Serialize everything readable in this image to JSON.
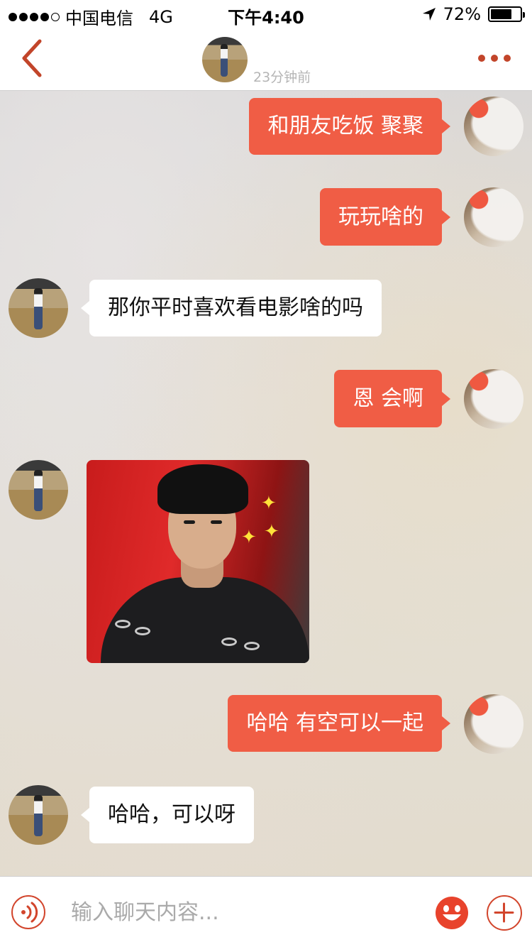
{
  "status_bar": {
    "carrier": "中国电信",
    "network": "4G",
    "time": "下午4:40",
    "battery": "72%",
    "battery_level": 0.72,
    "signal_filled": 4,
    "signal_total": 5
  },
  "header": {
    "last_seen": "23分钟前"
  },
  "messages": [
    {
      "direction": "out",
      "type": "text",
      "text": "和朋友吃饭 聚聚"
    },
    {
      "direction": "out",
      "type": "text",
      "text": "玩玩啥的"
    },
    {
      "direction": "in",
      "type": "text",
      "text": "那你平时喜欢看电影啥的吗"
    },
    {
      "direction": "out",
      "type": "text",
      "text": "恩 会啊"
    },
    {
      "direction": "in",
      "type": "image"
    },
    {
      "direction": "out",
      "type": "text",
      "text": "哈哈 有空可以一起"
    },
    {
      "direction": "in",
      "type": "text",
      "text": "哈哈，可以呀"
    }
  ],
  "input": {
    "placeholder": "输入聊天内容...",
    "value": ""
  },
  "colors": {
    "accent": "#f05d45",
    "icon": "#d2452c",
    "header_icon": "#c2452a",
    "incoming_bubble": "#ffffff"
  },
  "icons": [
    "back-arrow-icon",
    "more-dots-icon",
    "voice-icon",
    "emoji-icon",
    "plus-icon",
    "location-arrow-icon"
  ]
}
